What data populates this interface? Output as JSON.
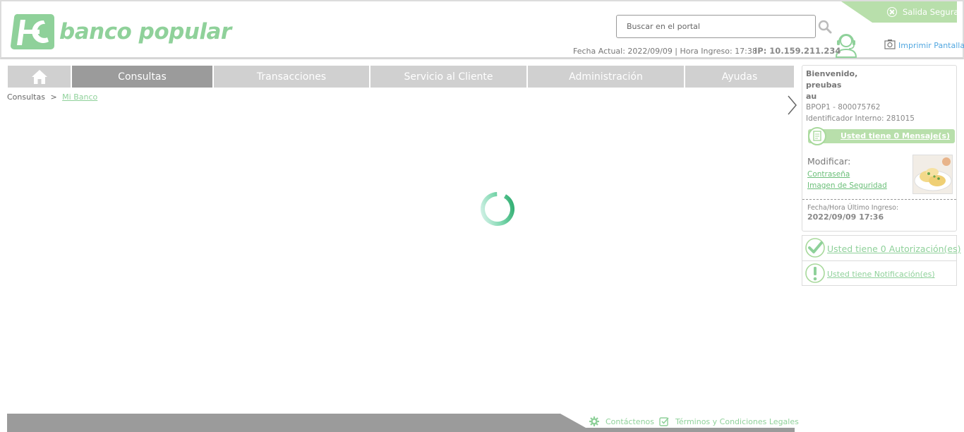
{
  "header": {
    "brand": "banco popular",
    "exit_label": "Salida Segura",
    "search_placeholder": "Buscar en el portal",
    "date_line": "Fecha Actual: 2022/09/09 | Hora Ingreso: 17:38",
    "ip_line": "IP: 10.159.211.234",
    "print_label": "Imprimir Pantalla"
  },
  "nav": {
    "items": [
      {
        "label": "Consultas",
        "active": true
      },
      {
        "label": "Transacciones"
      },
      {
        "label": "Servicio al Cliente"
      },
      {
        "label": "Administración"
      },
      {
        "label": "Ayudas"
      }
    ]
  },
  "breadcrumb": {
    "root": "Consultas",
    "separator": ">",
    "current": "Mi Banco"
  },
  "user_panel": {
    "welcome": "Bienvenido,",
    "name_line1": "preubas",
    "name_line2": "au",
    "account": "BPOP1 - 800075762",
    "internal_id": "Identificador Interno: 281015",
    "messages": "Usted tiene 0 Mensaje(s)",
    "modify_title": "Modificar:",
    "password_link": "Contraseña",
    "security_image_link": "Imagen de Seguridad",
    "last_login_label": "Fecha/Hora Último Ingreso:",
    "last_login_value": "2022/09/09 17:36"
  },
  "alerts": {
    "authorizations": "Usted tiene 0 Autorización(es)",
    "notifications": "Usted tiene Notificación(es)"
  },
  "footer": {
    "contact": "Contáctenos",
    "terms": "Términos y Condiciones Legales"
  },
  "colors": {
    "brand_green": "#8fd19a",
    "nav_inactive": "#d0d0d0",
    "nav_active": "#9b9b9b",
    "link_blue": "#52a7e0"
  }
}
